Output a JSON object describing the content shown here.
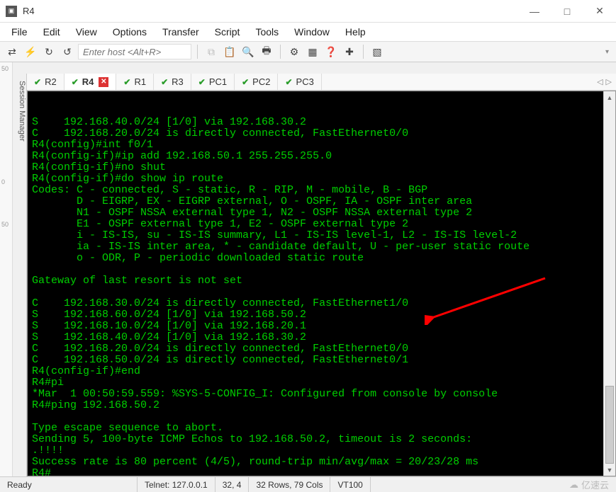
{
  "window": {
    "title": "R4",
    "min": "—",
    "max": "□",
    "close": "✕"
  },
  "menu": {
    "file": "File",
    "edit": "Edit",
    "view": "View",
    "options": "Options",
    "transfer": "Transfer",
    "script": "Script",
    "tools": "Tools",
    "window": "Window",
    "help": "Help"
  },
  "toolbar": {
    "host_placeholder": "Enter host <Alt+R>",
    "icons": {
      "connect": "⇄",
      "quick": "⚡",
      "reconnect": "↻",
      "disconnect": "↺",
      "copy": "⧉",
      "paste": "📋",
      "find": "🔍",
      "print": "🖶",
      "settings": "⚙",
      "sessions": "▦",
      "help": "❓",
      "new": "✚",
      "extra": "▧"
    }
  },
  "sidebar": {
    "label": "Session Manager"
  },
  "tabs": [
    {
      "label": "R2",
      "active": false,
      "closeable": false
    },
    {
      "label": "R4",
      "active": true,
      "closeable": true
    },
    {
      "label": "R1",
      "active": false,
      "closeable": false
    },
    {
      "label": "R3",
      "active": false,
      "closeable": false
    },
    {
      "label": "PC1",
      "active": false,
      "closeable": false
    },
    {
      "label": "PC2",
      "active": false,
      "closeable": false
    },
    {
      "label": "PC3",
      "active": false,
      "closeable": false
    }
  ],
  "tabnav": {
    "left": "◁",
    "right": "▷"
  },
  "terminal": {
    "lines": [
      "S    192.168.40.0/24 [1/0] via 192.168.30.2",
      "C    192.168.20.0/24 is directly connected, FastEthernet0/0",
      "R4(config)#int f0/1",
      "R4(config-if)#ip add 192.168.50.1 255.255.255.0",
      "R4(config-if)#no shut",
      "R4(config-if)#do show ip route",
      "Codes: C - connected, S - static, R - RIP, M - mobile, B - BGP",
      "       D - EIGRP, EX - EIGRP external, O - OSPF, IA - OSPF inter area",
      "       N1 - OSPF NSSA external type 1, N2 - OSPF NSSA external type 2",
      "       E1 - OSPF external type 1, E2 - OSPF external type 2",
      "       i - IS-IS, su - IS-IS summary, L1 - IS-IS level-1, L2 - IS-IS level-2",
      "       ia - IS-IS inter area, * - candidate default, U - per-user static route",
      "       o - ODR, P - periodic downloaded static route",
      "",
      "Gateway of last resort is not set",
      "",
      "C    192.168.30.0/24 is directly connected, FastEthernet1/0",
      "S    192.168.60.0/24 [1/0] via 192.168.50.2",
      "S    192.168.10.0/24 [1/0] via 192.168.20.1",
      "S    192.168.40.0/24 [1/0] via 192.168.30.2",
      "C    192.168.20.0/24 is directly connected, FastEthernet0/0",
      "C    192.168.50.0/24 is directly connected, FastEthernet0/1",
      "R4(config-if)#end",
      "R4#pi",
      "*Mar  1 00:50:59.559: %SYS-5-CONFIG_I: Configured from console by console",
      "R4#ping 192.168.50.2",
      "",
      "Type escape sequence to abort.",
      "Sending 5, 100-byte ICMP Echos to 192.168.50.2, timeout is 2 seconds:",
      ".!!!!",
      "Success rate is 80 percent (4/5), round-trip min/avg/max = 20/23/28 ms",
      "R4#"
    ]
  },
  "ruler": {
    "t50a": "50",
    "t0": "0",
    "t50b": "50"
  },
  "status": {
    "ready": "Ready",
    "conn": "Telnet: 127.0.0.1",
    "pos": "32,  4",
    "size": "32 Rows, 79 Cols",
    "emul": "VT100",
    "watermark": "亿速云"
  }
}
